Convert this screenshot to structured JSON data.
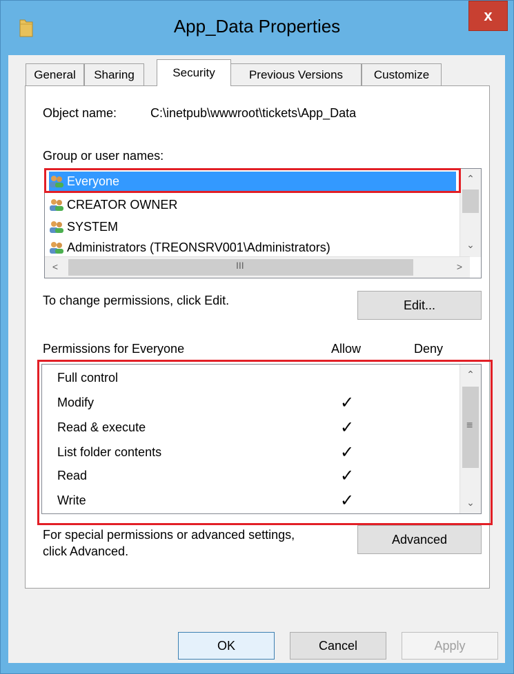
{
  "window": {
    "title": "App_Data Properties",
    "close_label": "x",
    "icon": "folder-icon"
  },
  "tabs": [
    {
      "label": "General"
    },
    {
      "label": "Sharing"
    },
    {
      "label": "Security",
      "active": true
    },
    {
      "label": "Previous Versions"
    },
    {
      "label": "Customize"
    }
  ],
  "security": {
    "object_name_label": "Object name:",
    "object_name_value": "C:\\inetpub\\wwwroot\\tickets\\App_Data",
    "group_label": "Group or user names:",
    "users": [
      {
        "name": "Everyone",
        "selected": true
      },
      {
        "name": "CREATOR OWNER"
      },
      {
        "name": "SYSTEM"
      },
      {
        "name": "Administrators (TREONSRV001\\Administrators)"
      }
    ],
    "change_text": "To change permissions, click Edit.",
    "edit_label": "Edit...",
    "permissions_for": "Permissions for Everyone",
    "allow_header": "Allow",
    "deny_header": "Deny",
    "permissions": [
      {
        "name": "Full control",
        "allow": false
      },
      {
        "name": "Modify",
        "allow": true
      },
      {
        "name": "Read & execute",
        "allow": true
      },
      {
        "name": "List folder contents",
        "allow": true
      },
      {
        "name": "Read",
        "allow": true
      },
      {
        "name": "Write",
        "allow": true
      }
    ],
    "check_glyph": "✓",
    "advanced_text_1": "For special permissions or advanced settings,",
    "advanced_text_2": "click Advanced.",
    "advanced_label": "Advanced"
  },
  "footer": {
    "ok_label": "OK",
    "cancel_label": "Cancel",
    "apply_label": "Apply"
  },
  "colors": {
    "accent": "#3399ff",
    "highlight_box": "#e21f26",
    "title_bar": "#67b3e4",
    "close_button": "#c84031"
  }
}
